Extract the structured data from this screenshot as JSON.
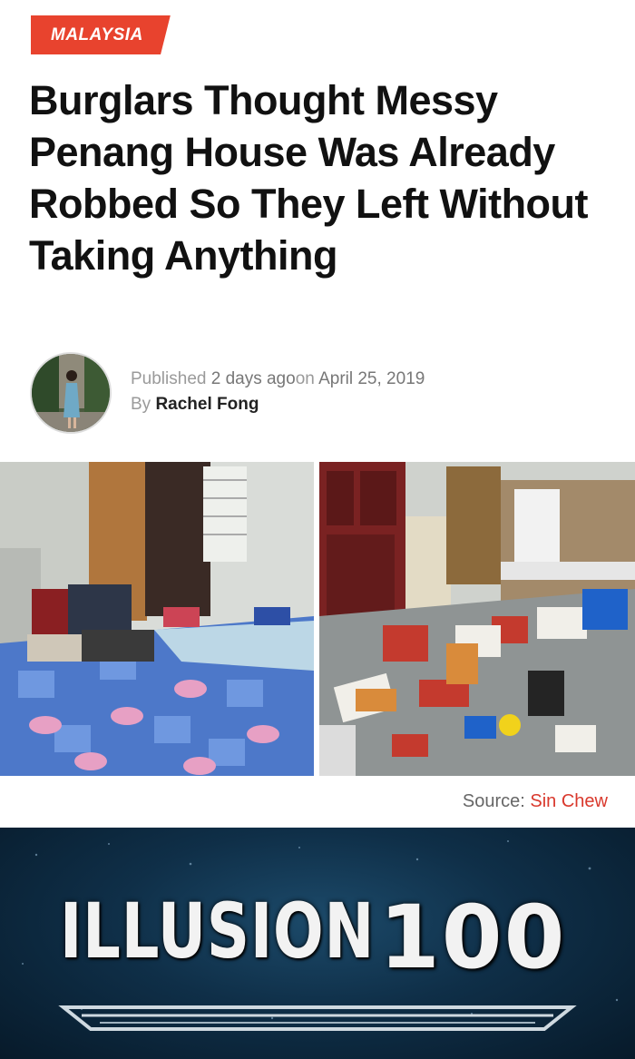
{
  "article": {
    "category": "MALAYSIA",
    "headline": "Burglars Thought Messy Penang House Was Already Robbed So They Left Without Taking Anything",
    "byline": {
      "published_prefix": "Published ",
      "relative_time": "2 days ago",
      "on_text": "on ",
      "date": "April 25, 2019",
      "by_prefix": "By ",
      "author": "Rachel Fong"
    },
    "source": {
      "label": "Source: ",
      "name": "Sin Chew"
    }
  },
  "meme": {
    "skill": "ILLUSION",
    "level": "100"
  },
  "colors": {
    "accent_red": "#e8432e",
    "link_red": "#d9382c",
    "meme_bg": "#0f2f48"
  }
}
